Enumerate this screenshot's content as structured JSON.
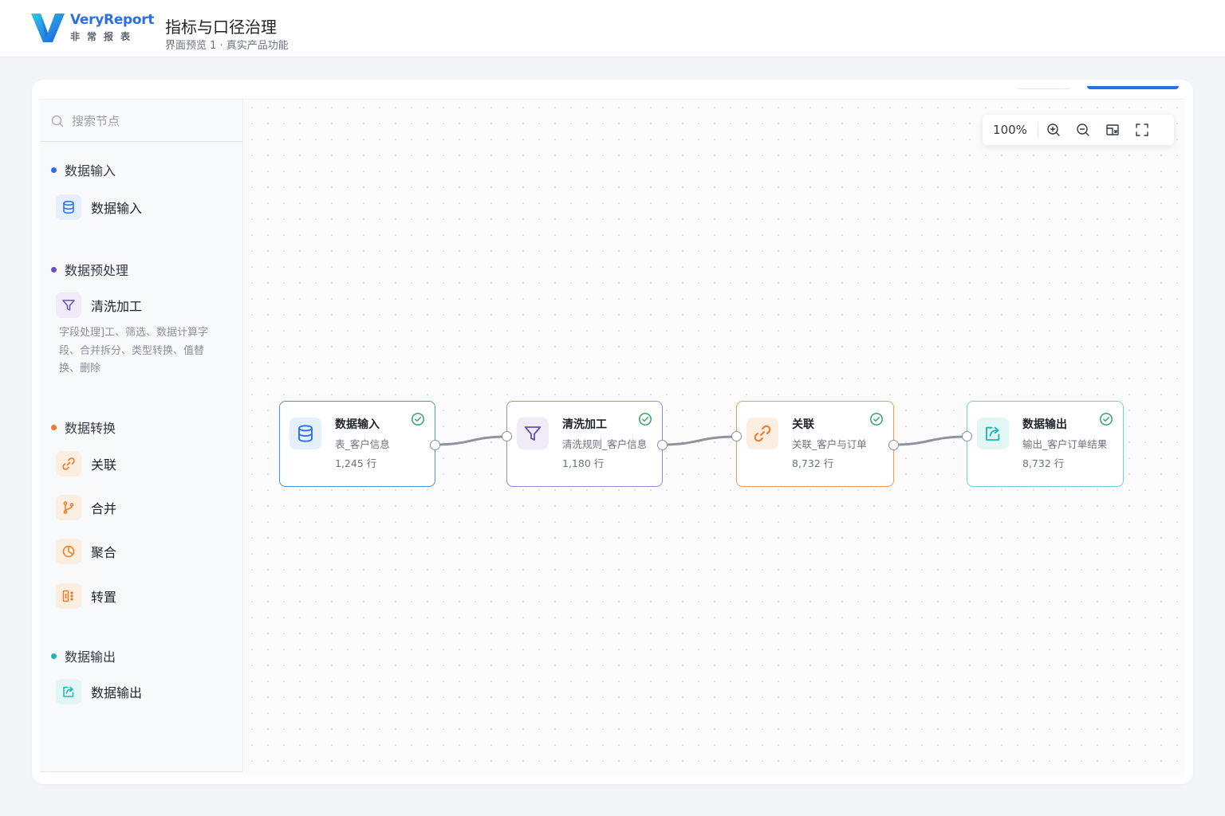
{
  "brand": {
    "name": "VeryReport",
    "name_cn": "非常报表",
    "color": "#2a6ee8"
  },
  "header": {
    "title": "指标与口径治理",
    "subtitle": "界面预览 1 · 真实产品功能"
  },
  "sidebar": {
    "search_placeholder": "搜索节点",
    "groups": [
      {
        "title": "数据输入",
        "dot_color": "#2a6ee8",
        "items": [
          {
            "label": "数据输入",
            "icon": "database-icon"
          }
        ]
      },
      {
        "title": "数据预处理",
        "dot_color": "#6b4fbb",
        "items": [
          {
            "label": "清洗加工",
            "icon": "filter-icon",
            "description": "字段处理]工、筛选、数据计算字段、合并拆分、类型转换、值替换、删除"
          }
        ]
      },
      {
        "title": "数据转换",
        "dot_color": "#f07a23",
        "items": [
          {
            "label": "关联",
            "icon": "link-icon"
          },
          {
            "label": "合并",
            "icon": "merge-branch-icon"
          },
          {
            "label": "聚合",
            "icon": "pie-aggregate-icon"
          },
          {
            "label": "转置",
            "icon": "transpose-icon"
          }
        ]
      },
      {
        "title": "数据输出",
        "dot_color": "#1fb5b5",
        "items": [
          {
            "label": "数据输出",
            "icon": "export-icon"
          }
        ]
      }
    ]
  },
  "canvas": {
    "zoom_level": "100%",
    "nodes": [
      {
        "title": "数据输入",
        "subtitle": "表_客户信息",
        "rows": "1,245 行",
        "icon": "database-icon",
        "color": "#4a8ef0",
        "status": "success"
      },
      {
        "title": "清洗加工",
        "subtitle": "清洗规则_客户信息",
        "rows": "1,180 行",
        "icon": "filter-icon",
        "color": "#9a8ad8",
        "status": "success"
      },
      {
        "title": "关联",
        "subtitle": "关联_客户与订单",
        "rows": "8,732 行",
        "icon": "link-icon",
        "color": "#f39a4e",
        "status": "success"
      },
      {
        "title": "数据输出",
        "subtitle": "输出_客户订单结果",
        "rows": "8,732 行",
        "icon": "export-icon",
        "color": "#6fd0d0",
        "status": "success"
      }
    ]
  }
}
